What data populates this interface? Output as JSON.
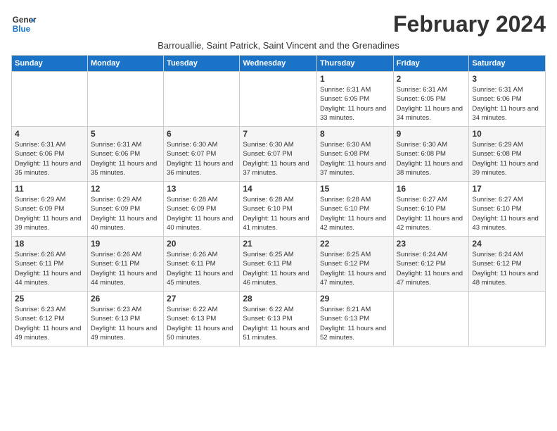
{
  "header": {
    "logo_line1": "General",
    "logo_line2": "Blue",
    "month_title": "February 2024",
    "subtitle": "Barrouallie, Saint Patrick, Saint Vincent and the Grenadines"
  },
  "weekdays": [
    "Sunday",
    "Monday",
    "Tuesday",
    "Wednesday",
    "Thursday",
    "Friday",
    "Saturday"
  ],
  "weeks": [
    [
      {
        "day": "",
        "detail": ""
      },
      {
        "day": "",
        "detail": ""
      },
      {
        "day": "",
        "detail": ""
      },
      {
        "day": "",
        "detail": ""
      },
      {
        "day": "1",
        "detail": "Sunrise: 6:31 AM\nSunset: 6:05 PM\nDaylight: 11 hours\nand 33 minutes."
      },
      {
        "day": "2",
        "detail": "Sunrise: 6:31 AM\nSunset: 6:05 PM\nDaylight: 11 hours\nand 34 minutes."
      },
      {
        "day": "3",
        "detail": "Sunrise: 6:31 AM\nSunset: 6:06 PM\nDaylight: 11 hours\nand 34 minutes."
      }
    ],
    [
      {
        "day": "4",
        "detail": "Sunrise: 6:31 AM\nSunset: 6:06 PM\nDaylight: 11 hours\nand 35 minutes."
      },
      {
        "day": "5",
        "detail": "Sunrise: 6:31 AM\nSunset: 6:06 PM\nDaylight: 11 hours\nand 35 minutes."
      },
      {
        "day": "6",
        "detail": "Sunrise: 6:30 AM\nSunset: 6:07 PM\nDaylight: 11 hours\nand 36 minutes."
      },
      {
        "day": "7",
        "detail": "Sunrise: 6:30 AM\nSunset: 6:07 PM\nDaylight: 11 hours\nand 37 minutes."
      },
      {
        "day": "8",
        "detail": "Sunrise: 6:30 AM\nSunset: 6:08 PM\nDaylight: 11 hours\nand 37 minutes."
      },
      {
        "day": "9",
        "detail": "Sunrise: 6:30 AM\nSunset: 6:08 PM\nDaylight: 11 hours\nand 38 minutes."
      },
      {
        "day": "10",
        "detail": "Sunrise: 6:29 AM\nSunset: 6:08 PM\nDaylight: 11 hours\nand 39 minutes."
      }
    ],
    [
      {
        "day": "11",
        "detail": "Sunrise: 6:29 AM\nSunset: 6:09 PM\nDaylight: 11 hours\nand 39 minutes."
      },
      {
        "day": "12",
        "detail": "Sunrise: 6:29 AM\nSunset: 6:09 PM\nDaylight: 11 hours\nand 40 minutes."
      },
      {
        "day": "13",
        "detail": "Sunrise: 6:28 AM\nSunset: 6:09 PM\nDaylight: 11 hours\nand 40 minutes."
      },
      {
        "day": "14",
        "detail": "Sunrise: 6:28 AM\nSunset: 6:10 PM\nDaylight: 11 hours\nand 41 minutes."
      },
      {
        "day": "15",
        "detail": "Sunrise: 6:28 AM\nSunset: 6:10 PM\nDaylight: 11 hours\nand 42 minutes."
      },
      {
        "day": "16",
        "detail": "Sunrise: 6:27 AM\nSunset: 6:10 PM\nDaylight: 11 hours\nand 42 minutes."
      },
      {
        "day": "17",
        "detail": "Sunrise: 6:27 AM\nSunset: 6:10 PM\nDaylight: 11 hours\nand 43 minutes."
      }
    ],
    [
      {
        "day": "18",
        "detail": "Sunrise: 6:26 AM\nSunset: 6:11 PM\nDaylight: 11 hours\nand 44 minutes."
      },
      {
        "day": "19",
        "detail": "Sunrise: 6:26 AM\nSunset: 6:11 PM\nDaylight: 11 hours\nand 44 minutes."
      },
      {
        "day": "20",
        "detail": "Sunrise: 6:26 AM\nSunset: 6:11 PM\nDaylight: 11 hours\nand 45 minutes."
      },
      {
        "day": "21",
        "detail": "Sunrise: 6:25 AM\nSunset: 6:11 PM\nDaylight: 11 hours\nand 46 minutes."
      },
      {
        "day": "22",
        "detail": "Sunrise: 6:25 AM\nSunset: 6:12 PM\nDaylight: 11 hours\nand 47 minutes."
      },
      {
        "day": "23",
        "detail": "Sunrise: 6:24 AM\nSunset: 6:12 PM\nDaylight: 11 hours\nand 47 minutes."
      },
      {
        "day": "24",
        "detail": "Sunrise: 6:24 AM\nSunset: 6:12 PM\nDaylight: 11 hours\nand 48 minutes."
      }
    ],
    [
      {
        "day": "25",
        "detail": "Sunrise: 6:23 AM\nSunset: 6:12 PM\nDaylight: 11 hours\nand 49 minutes."
      },
      {
        "day": "26",
        "detail": "Sunrise: 6:23 AM\nSunset: 6:13 PM\nDaylight: 11 hours\nand 49 minutes."
      },
      {
        "day": "27",
        "detail": "Sunrise: 6:22 AM\nSunset: 6:13 PM\nDaylight: 11 hours\nand 50 minutes."
      },
      {
        "day": "28",
        "detail": "Sunrise: 6:22 AM\nSunset: 6:13 PM\nDaylight: 11 hours\nand 51 minutes."
      },
      {
        "day": "29",
        "detail": "Sunrise: 6:21 AM\nSunset: 6:13 PM\nDaylight: 11 hours\nand 52 minutes."
      },
      {
        "day": "",
        "detail": ""
      },
      {
        "day": "",
        "detail": ""
      }
    ]
  ]
}
